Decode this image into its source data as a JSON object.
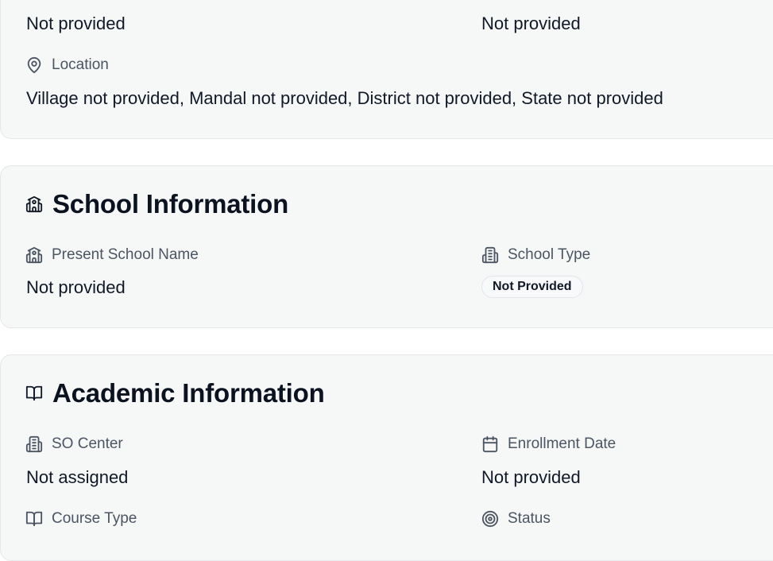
{
  "personal": {
    "value_left": "Not provided",
    "value_right": "Not provided",
    "location_label": "Location",
    "location_icon": "map-pin-icon",
    "location_value": "Village not provided, Mandal not provided, District not provided, State not provided"
  },
  "school": {
    "title": "School Information",
    "title_icon": "school-icon",
    "present_school_label": "Present School Name",
    "present_school_icon": "school-icon",
    "present_school_value": "Not provided",
    "school_type_label": "School Type",
    "school_type_icon": "building-icon",
    "school_type_badge": "Not Provided"
  },
  "academic": {
    "title": "Academic Information",
    "title_icon": "book-open-icon",
    "so_center_label": "SO Center",
    "so_center_icon": "building-icon",
    "so_center_value": "Not assigned",
    "enrollment_label": "Enrollment Date",
    "enrollment_icon": "calendar-icon",
    "enrollment_value": "Not provided",
    "course_type_label": "Course Type",
    "course_type_icon": "book-open-icon",
    "status_label": "Status",
    "status_icon": "target-icon"
  }
}
